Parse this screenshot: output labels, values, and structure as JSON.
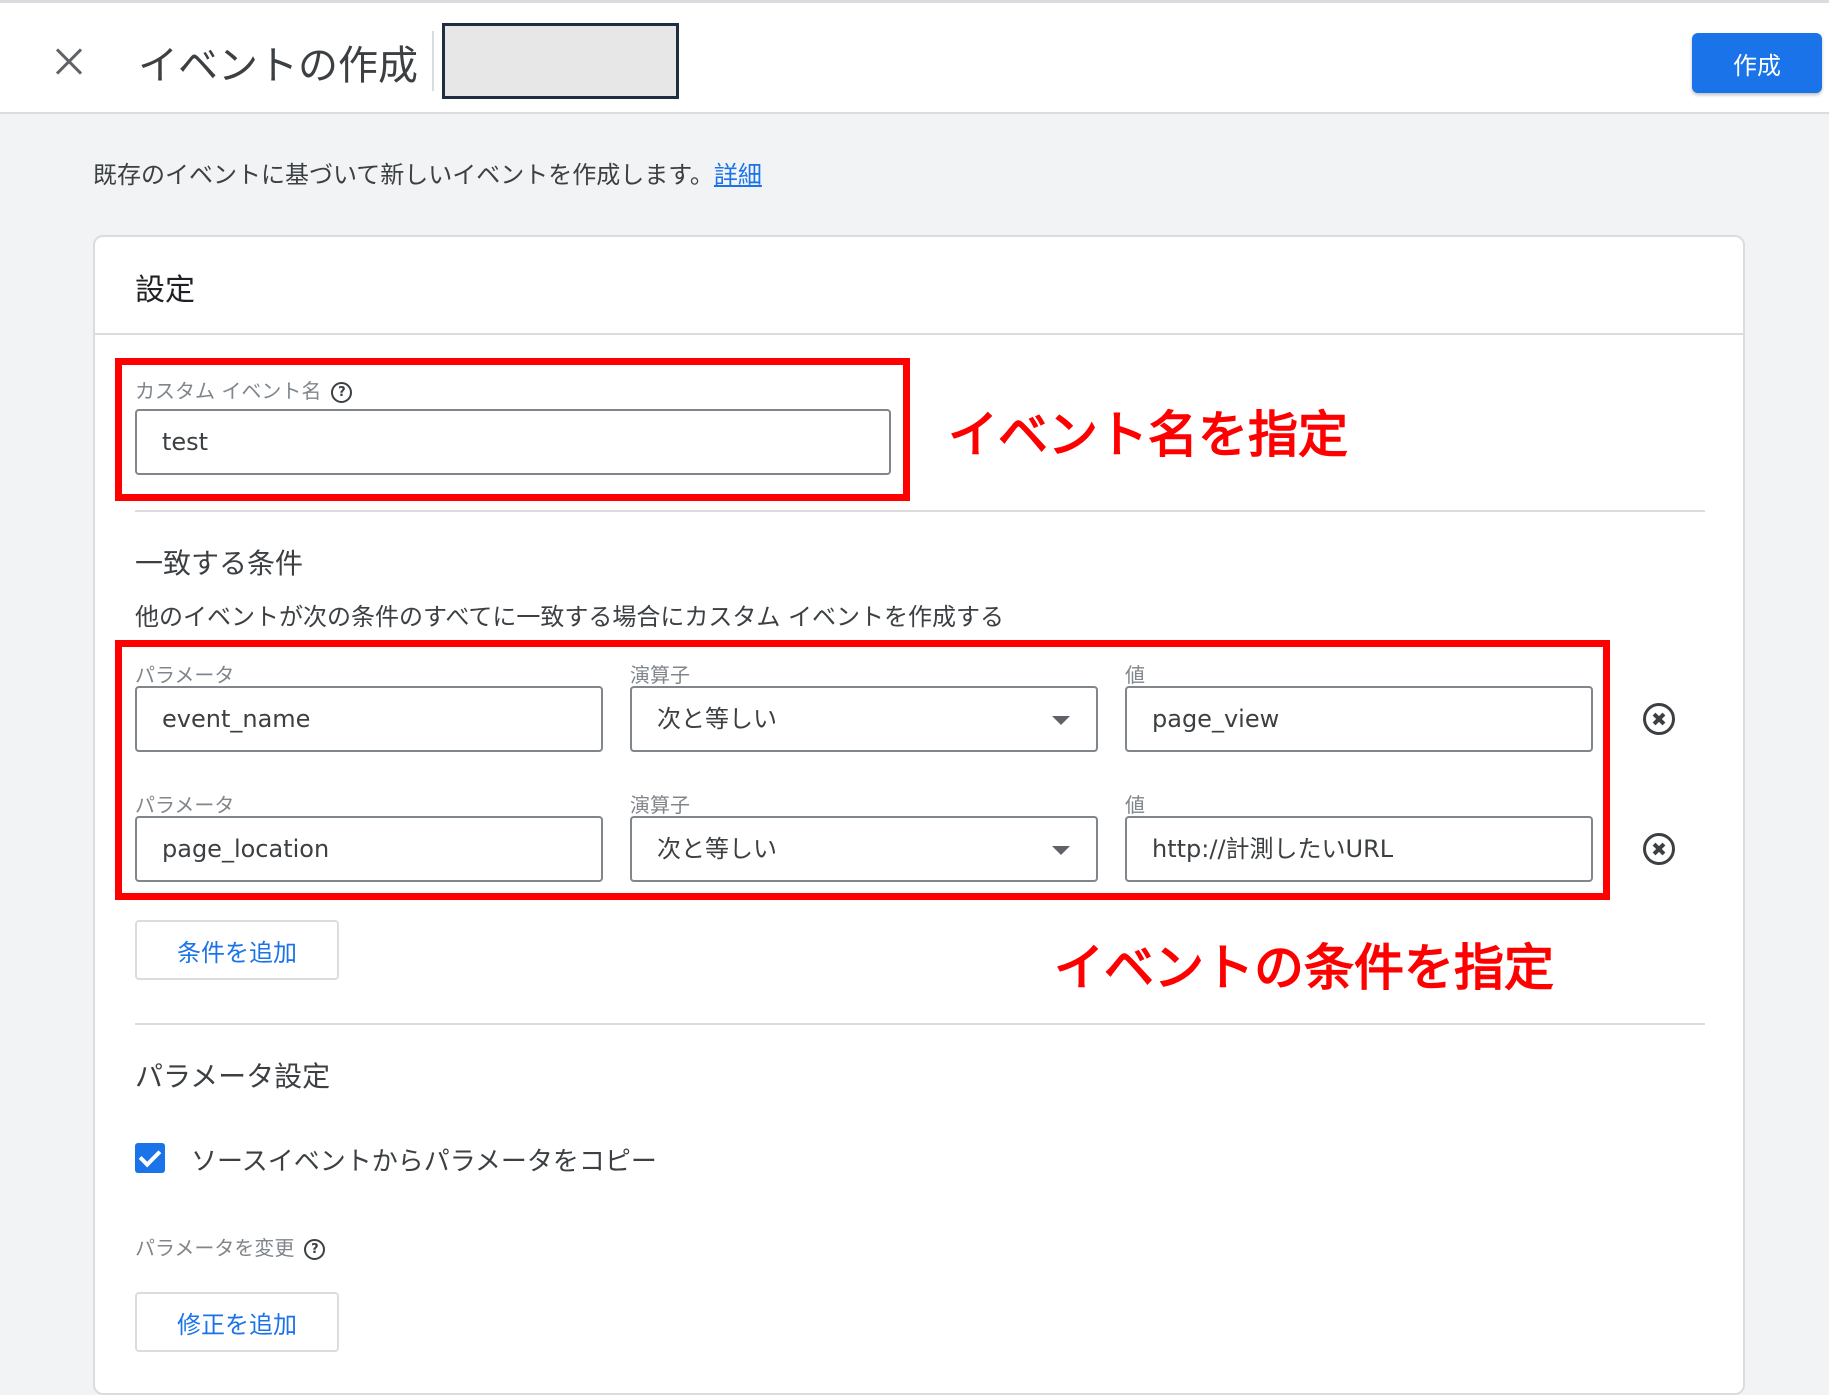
{
  "header": {
    "title": "イベントの作成",
    "create_label": "作成"
  },
  "intro": {
    "text": "既存のイベントに基づいて新しいイベントを作成します。",
    "link": "詳細"
  },
  "card": {
    "title": "設定",
    "custom_event_name": {
      "label": "カスタム イベント名",
      "value": "test"
    },
    "conditions": {
      "title": "一致する条件",
      "description": "他のイベントが次の条件のすべてに一致する場合にカスタム イベントを作成する",
      "rows": [
        {
          "param_label": "パラメータ",
          "param": "event_name",
          "op_label": "演算子",
          "op": "次と等しい",
          "value_label": "値",
          "value": "page_view"
        },
        {
          "param_label": "パラメータ",
          "param": "page_location",
          "op_label": "演算子",
          "op": "次と等しい",
          "value_label": "値",
          "value": "http://計測したいURL"
        }
      ],
      "add_label": "条件を追加"
    },
    "params": {
      "title": "パラメータ設定",
      "copy_label": "ソースイベントからパラメータをコピー",
      "copy_checked": true,
      "modify_label": "パラメータを変更",
      "add_mod_label": "修正を追加"
    }
  },
  "annotations": {
    "name": "イベント名を指定",
    "conditions": "イベントの条件を指定"
  },
  "colors": {
    "accent": "#1a73e8",
    "highlight": "#ff0000"
  }
}
